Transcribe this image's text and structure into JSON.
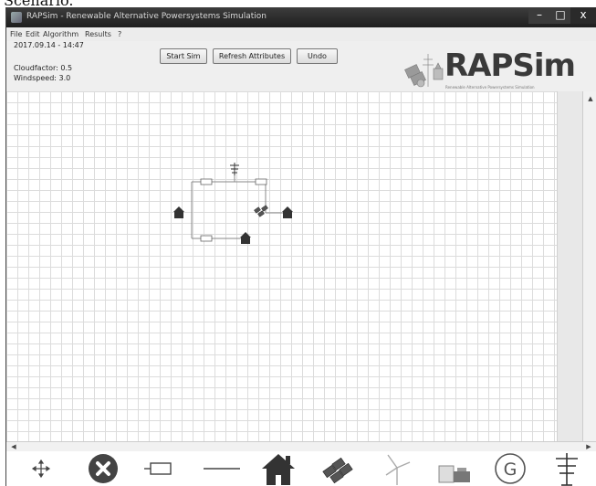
{
  "caption": "Scenario.",
  "window": {
    "title": "RAPSim - Renewable Alternative Powersystems Simulation",
    "controls": {
      "minimize": "–",
      "maximize": "□",
      "close": "x"
    }
  },
  "menu": [
    "File",
    "Edit",
    "Algorithm",
    "Results",
    "?"
  ],
  "status": {
    "datetime": "2017.09.14 - 14:47",
    "cloudfactor": "Cloudfactor: 0.5",
    "windspeed": "Windspeed: 3.0"
  },
  "toolbar": {
    "start_sim": "Start Sim",
    "refresh_attributes": "Refresh Attributes",
    "undo": "Undo"
  },
  "logo": {
    "name": "RAPSim",
    "tagline": "Renewable Alternative Powersystems Simulation"
  },
  "palette_tools": [
    {
      "name": "move-tool",
      "icon": "move-icon"
    },
    {
      "name": "delete-tool",
      "icon": "delete-icon"
    },
    {
      "name": "bus-tool",
      "icon": "bus-icon"
    },
    {
      "name": "line-tool",
      "icon": "line-icon"
    },
    {
      "name": "house-tool",
      "icon": "house-icon"
    },
    {
      "name": "solar-panel-tool",
      "icon": "solar-panel-icon"
    },
    {
      "name": "wind-turbine-tool",
      "icon": "wind-turbine-icon"
    },
    {
      "name": "battery-tool",
      "icon": "battery-icon"
    },
    {
      "name": "generator-tool",
      "icon": "generator-icon"
    },
    {
      "name": "grid-tower-tool",
      "icon": "grid-tower-icon"
    }
  ],
  "palette_labels": {
    "generator": "G"
  },
  "colors": {
    "titlebar": "#2b2b2b",
    "icon_fill": "#555555",
    "grid_line": "#dcdcdc"
  }
}
